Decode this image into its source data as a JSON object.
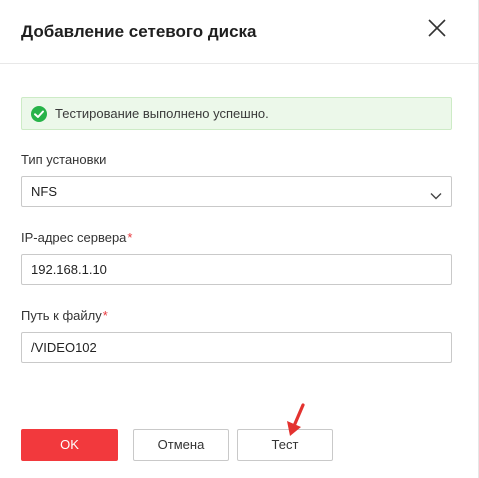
{
  "dialog": {
    "title": "Добавление сетевого диска",
    "close_icon": "close-icon"
  },
  "status": {
    "message": "Тестирование выполнено успешно.",
    "icon": "check-circle-icon",
    "color": "#27b349"
  },
  "form": {
    "install_type": {
      "label": "Тип установки",
      "value": "NFS",
      "icon": "chevron-down-icon"
    },
    "server_ip": {
      "label": "IP-адрес сервера",
      "required_mark": "*",
      "value": "192.168.1.10"
    },
    "file_path": {
      "label": "Путь к файлу",
      "required_mark": "*",
      "value": "/VIDEO102"
    }
  },
  "footer": {
    "ok_label": "OK",
    "cancel_label": "Отмена",
    "test_label": "Тест"
  },
  "colors": {
    "accent": "#f2393d",
    "success": "#27b349",
    "success_bg": "#ecf8ea"
  }
}
